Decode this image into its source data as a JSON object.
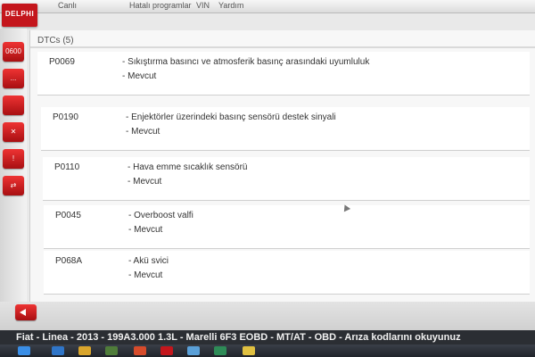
{
  "window": {
    "menu": [
      "Canlı",
      "Hatalı programlar",
      "VIN",
      "Yardım"
    ],
    "logo_text": "DELPHI"
  },
  "left_toolbar": [
    {
      "name": "dtc-tool-icon",
      "label": "0600"
    },
    {
      "name": "ecu-tool-icon",
      "label": "..."
    },
    {
      "name": "settings-tool-icon",
      "label": ""
    },
    {
      "name": "tools-tool-icon",
      "label": "✕"
    },
    {
      "name": "service-tool-icon",
      "label": "!"
    },
    {
      "name": "adapt-tool-icon",
      "label": "⇄"
    }
  ],
  "panel": {
    "title": "DTCs (5)",
    "rows": [
      {
        "code": "P0069",
        "desc": "- Sıkıştırma basıncı ve atmosferik basınç arasındaki uyumluluk",
        "state": "- Mevcut"
      },
      {
        "code": "P0190",
        "desc": "- Enjektörler üzerindeki basınç sensörü destek sinyali",
        "state": "- Mevcut"
      },
      {
        "code": "P0110",
        "desc": "- Hava emme sıcaklık sensörü",
        "state": "- Mevcut"
      },
      {
        "code": "P0045",
        "desc": "- Overboost valfi",
        "state": "- Mevcut"
      },
      {
        "code": "P068A",
        "desc": "- Akü svici",
        "state": "- Mevcut"
      }
    ]
  },
  "status_bar": {
    "text": "Fiat - Linea - 2013 - 199A3.000 1.3L - Marelli 6F3 EOBD - MT/AT - OBD - Arıza kodlarını okuyunuz"
  },
  "colors": {
    "brand_red": "#c4161c",
    "panel_bg": "#f7f7f7",
    "status_bg": "#2b2e33"
  }
}
